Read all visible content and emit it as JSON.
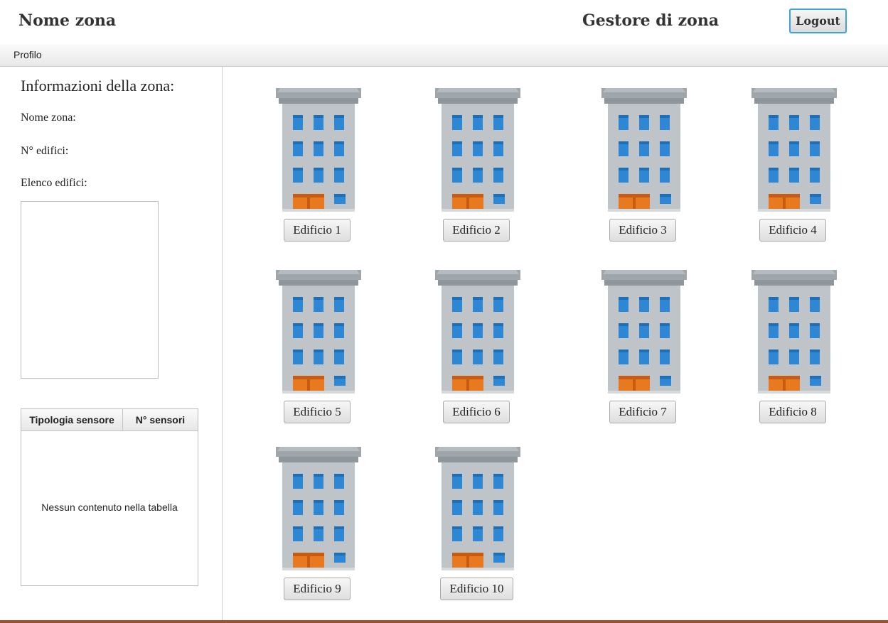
{
  "header": {
    "zone_name": "Nome zona",
    "role_title": "Gestore di zona",
    "logout_label": "Logout"
  },
  "menu": {
    "profile_label": "Profilo"
  },
  "sidebar": {
    "heading": "Informazioni della zona:",
    "zone_name_label": "Nome zona:",
    "building_count_label": "N° edifici:",
    "building_list_label": "Elenco edifici:",
    "sensor_table": {
      "columns": [
        "Tipologia sensore",
        "N° sensori"
      ],
      "empty_message": "Nessun contenuto nella tabella"
    }
  },
  "buildings": [
    {
      "label": "Edificio 1"
    },
    {
      "label": "Edificio 2"
    },
    {
      "label": "Edificio 3"
    },
    {
      "label": "Edificio 4"
    },
    {
      "label": "Edificio 5"
    },
    {
      "label": "Edificio 6"
    },
    {
      "label": "Edificio 7"
    },
    {
      "label": "Edificio 8"
    },
    {
      "label": "Edificio 9"
    },
    {
      "label": "Edificio 10"
    }
  ],
  "colors": {
    "roof": "#9ea6ab",
    "facade": "#bfc4c8",
    "window": "#2e87d4",
    "door": "#e8791f",
    "accent": "#3fa3d9",
    "bottom_bar": "#a0522d"
  },
  "icons": {
    "building": "building-icon"
  }
}
